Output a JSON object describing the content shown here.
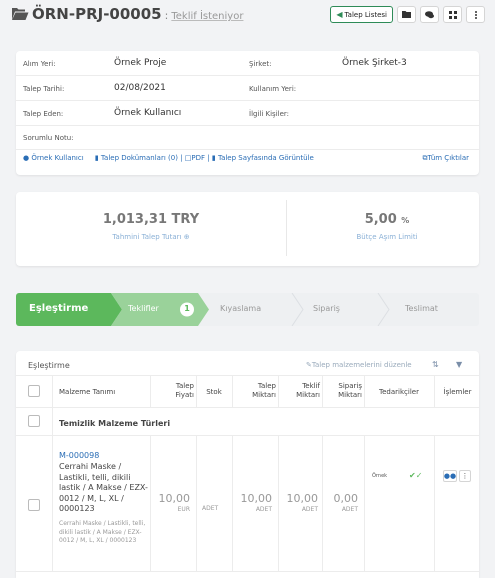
{
  "header": {
    "title_code": "ÖRN-PRJ-00005",
    "separator": ":",
    "status": "Teklif İsteniyor",
    "back_button": "Talep Listesi",
    "icons": [
      "folder-icon",
      "chat-icon",
      "grid-icon",
      "more-icon"
    ]
  },
  "info": {
    "rows": [
      {
        "label": "Alım Yeri:",
        "value": "Örnek Proje",
        "label2": "Şirket:",
        "value2": "Örnek Şirket-3"
      },
      {
        "label": "Talep Tarihi:",
        "value": "02/08/2021",
        "label2": "Kullanım Yeri:",
        "value2": ""
      },
      {
        "label": "Talep Eden:",
        "value": "Örnek Kullanıcı",
        "label2": "İlgili Kişiler:",
        "value2": ""
      },
      {
        "label": "Sorumlu Notu:",
        "value": "",
        "label2": "",
        "value2": ""
      }
    ],
    "links": {
      "user": "Örnek Kullanıcı",
      "docs": "Talep Dokümanları (0)",
      "sep": "|",
      "pdf": "PDF",
      "view": "Talep Sayfasında Görüntüle",
      "all_outputs": "Tüm Çıktılar"
    }
  },
  "totals": {
    "amount": "1,013,31 TRY",
    "amount_caption": "Tahmini Talep Tutarı ⊕",
    "limit": "5,00",
    "limit_unit": "%",
    "limit_caption": "Bütçe Aşım Limiti"
  },
  "steps": [
    {
      "label": "Eşleştirme",
      "state": "done"
    },
    {
      "label": "Teklifler",
      "state": "active",
      "badge": "1"
    },
    {
      "label": "Kıyaslama",
      "state": "todo"
    },
    {
      "label": "Sipariş",
      "state": "todo"
    },
    {
      "label": "Teslimat",
      "state": "todo"
    }
  ],
  "table": {
    "title": "Eşleştirme",
    "edit_link": "Talep malzemelerini düzenle",
    "columns": {
      "material": "Malzeme Tanımı",
      "price_1": "Talep",
      "price_2": "Fiyatı",
      "stock": "Stok",
      "req_1": "Talep",
      "req_2": "Miktarı",
      "offer_1": "Teklif",
      "offer_2": "Miktarı",
      "order_1": "Sipariş",
      "order_2": "Miktarı",
      "suppliers": "Tedarikçiler",
      "actions": "İşlemler"
    },
    "group": "Temizlik Malzeme Türleri",
    "row": {
      "code": "M-000098",
      "description": "Cerrahi Maske / Lastikli, telli, dikili lastik / A Makse / EZX-0012 / M, L, XL / 0000123",
      "sub_description": "Cerrahi Maske / Lastikli, telli, dikili lastik / A Makse / EZX-0012 / M, L, XL / 0000123",
      "price": "10,00",
      "price_unit": "EUR",
      "stock_unit": "ADET",
      "req_qty": "10,00",
      "req_unit": "ADET",
      "offer_qty": "10,00",
      "offer_unit": "ADET",
      "order_qty": "0,00",
      "order_unit": "ADET",
      "supplier": "Örnek",
      "supplier_status": "✔✓"
    }
  },
  "colors": {
    "accent_green": "#5cb85c",
    "step_active": "#9ad29a",
    "link_blue": "#2a6db5"
  }
}
